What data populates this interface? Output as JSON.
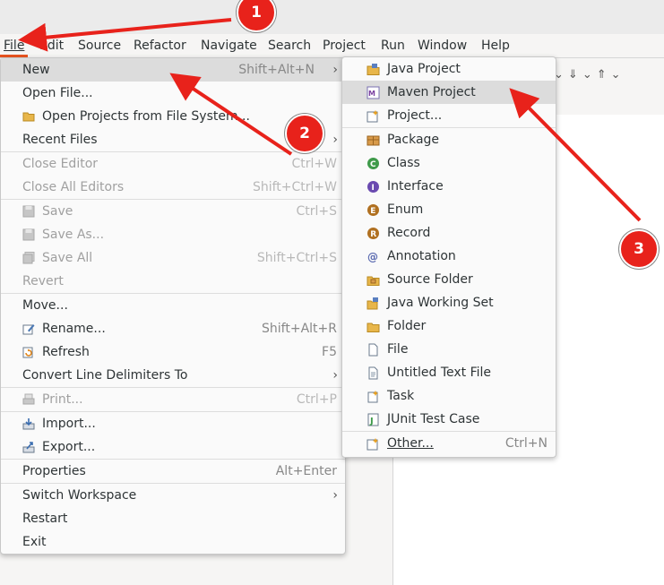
{
  "menubar": {
    "items": [
      {
        "label": "File"
      },
      {
        "label": "Edit"
      },
      {
        "label": "Source"
      },
      {
        "label": "Refactor"
      },
      {
        "label": "Navigate"
      },
      {
        "label": "Search"
      },
      {
        "label": "Project"
      },
      {
        "label": "Run"
      },
      {
        "label": "Window"
      },
      {
        "label": "Help"
      }
    ]
  },
  "file_menu": {
    "items": [
      {
        "label": "New",
        "accel": "Shift+Alt+N",
        "submenu": true
      },
      {
        "label": "Open File..."
      },
      {
        "label": "Open Projects from File System...",
        "icon": "folder-icon"
      },
      {
        "label": "Recent Files",
        "submenu": true
      },
      {
        "label": "Close Editor",
        "accel": "Ctrl+W",
        "disabled": true
      },
      {
        "label": "Close All Editors",
        "accel": "Shift+Ctrl+W",
        "disabled": true
      },
      {
        "label": "Save",
        "accel": "Ctrl+S",
        "disabled": true,
        "icon": "save-icon"
      },
      {
        "label": "Save As...",
        "disabled": true,
        "icon": "save-as-icon"
      },
      {
        "label": "Save All",
        "accel": "Shift+Ctrl+S",
        "disabled": true,
        "icon": "save-all-icon"
      },
      {
        "label": "Revert",
        "disabled": true
      },
      {
        "label": "Move..."
      },
      {
        "label": "Rename...",
        "accel": "Shift+Alt+R",
        "icon": "rename-icon"
      },
      {
        "label": "Refresh",
        "accel": "F5",
        "icon": "refresh-icon"
      },
      {
        "label": "Convert Line Delimiters To",
        "submenu": true
      },
      {
        "label": "Print...",
        "accel": "Ctrl+P",
        "disabled": true,
        "icon": "print-icon"
      },
      {
        "label": "Import...",
        "icon": "import-icon"
      },
      {
        "label": "Export...",
        "icon": "export-icon"
      },
      {
        "label": "Properties",
        "accel": "Alt+Enter"
      },
      {
        "label": "Switch Workspace",
        "submenu": true
      },
      {
        "label": "Restart"
      },
      {
        "label": "Exit"
      }
    ]
  },
  "new_submenu": {
    "items": [
      {
        "label": "Java Project",
        "icon": "java-project-icon"
      },
      {
        "label": "Maven Project",
        "icon": "maven-project-icon"
      },
      {
        "label": "Project...",
        "icon": "project-icon"
      },
      {
        "label": "Package",
        "icon": "package-icon"
      },
      {
        "label": "Class",
        "icon": "class-icon"
      },
      {
        "label": "Interface",
        "icon": "interface-icon"
      },
      {
        "label": "Enum",
        "icon": "enum-icon"
      },
      {
        "label": "Record",
        "icon": "record-icon"
      },
      {
        "label": "Annotation",
        "icon": "annotation-icon"
      },
      {
        "label": "Source Folder",
        "icon": "source-folder-icon"
      },
      {
        "label": "Java Working Set",
        "icon": "working-set-icon"
      },
      {
        "label": "Folder",
        "icon": "folder-icon"
      },
      {
        "label": "File",
        "icon": "file-icon"
      },
      {
        "label": "Untitled Text File",
        "icon": "text-file-icon"
      },
      {
        "label": "Task",
        "icon": "task-icon"
      },
      {
        "label": "JUnit Test Case",
        "icon": "junit-icon"
      },
      {
        "label": "Other...",
        "accel": "Ctrl+N",
        "icon": "wizard-icon"
      }
    ]
  },
  "annotations": {
    "badges": [
      "1",
      "2",
      "3"
    ],
    "arrow_color": "#e8221b"
  },
  "colors": {
    "accent": "#e95420",
    "highlight": "#dcdcdc"
  }
}
